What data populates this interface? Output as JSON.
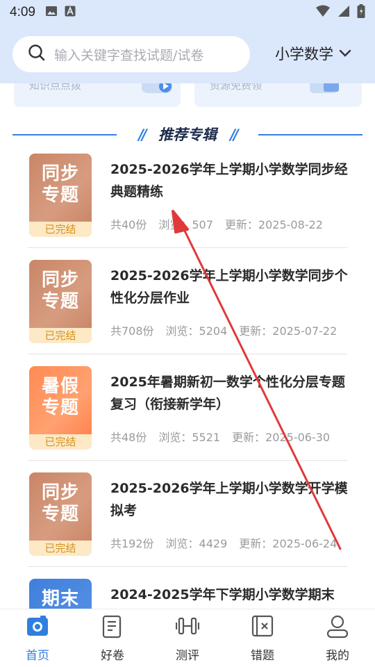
{
  "status": {
    "time": "4:09"
  },
  "search": {
    "placeholder": "输入关键字查找试题/试卷"
  },
  "subject": {
    "selected": "小学数学"
  },
  "top_cards": [
    {
      "caption": "知识点点拨"
    },
    {
      "caption": "资源免费领"
    }
  ],
  "section": {
    "title": "推荐专辑"
  },
  "items": [
    {
      "thumb_line1": "同步",
      "thumb_line2": "专题",
      "status": "已完结",
      "title": "2025-2026学年上学期小学数学同步经典题精练",
      "count": "共40份",
      "views": "浏览：507",
      "updated": "更新：2025-08-22"
    },
    {
      "thumb_line1": "同步",
      "thumb_line2": "专题",
      "status": "已完结",
      "title": "2025-2026学年上学期小学数学同步个性化分层作业",
      "count": "共708份",
      "views": "浏览：5204",
      "updated": "更新：2025-07-22"
    },
    {
      "thumb_line1": "暑假",
      "thumb_line2": "专题",
      "status": "已完结",
      "title": "2025年暑期新初一数学个性化分层专题复习（衔接新学年）",
      "count": "共48份",
      "views": "浏览：5521",
      "updated": "更新：2025-06-30"
    },
    {
      "thumb_line1": "同步",
      "thumb_line2": "专题",
      "status": "已完结",
      "title": "2025-2026学年上学期小学数学开学模拟考",
      "count": "共192份",
      "views": "浏览：4429",
      "updated": "更新：2025-06-24"
    },
    {
      "thumb_line1": "期末",
      "thumb_line2": "",
      "status": "",
      "title": "2024-2025学年下学期小学数学期末",
      "count": "",
      "views": "",
      "updated": ""
    }
  ],
  "nav": [
    {
      "label": "首页",
      "icon": "camera-icon",
      "active": true
    },
    {
      "label": "好卷",
      "icon": "document-icon",
      "active": false
    },
    {
      "label": "测评",
      "icon": "dumbbell-icon",
      "active": false
    },
    {
      "label": "错题",
      "icon": "wrong-question-icon",
      "active": false
    },
    {
      "label": "我的",
      "icon": "user-icon",
      "active": false
    }
  ],
  "colors": {
    "accent": "#2f7fe0",
    "header_bg": "#dbe7fb",
    "annotation": "#e0393b"
  }
}
